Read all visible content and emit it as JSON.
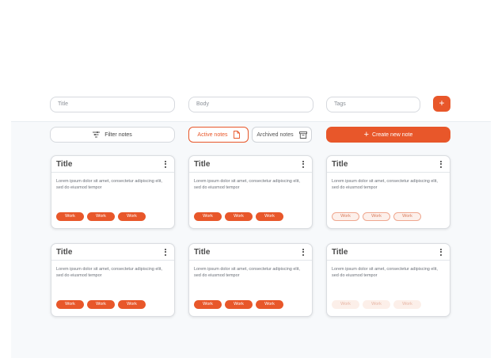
{
  "form": {
    "title_placeholder": "Title",
    "body_placeholder": "Body",
    "tags_placeholder": "Tags",
    "add_label": "+"
  },
  "toolbar": {
    "filter_label": "Filter notes",
    "active_label": "Active notes",
    "archived_label": "Archived notes",
    "create_label": "Create new note",
    "create_plus": "+"
  },
  "colors": {
    "accent": "#e8572a",
    "tag_outline_bg": "#fdf0eb",
    "tag_faint_bg": "#fcefe9"
  },
  "notes": [
    {
      "title": "Title",
      "body": "Lorem ipsum dolor sit amet, consectetur adipiscing elit, sed do eiusmod tempor",
      "tags": [
        "Work",
        "Work",
        "Work"
      ],
      "tag_style": "solid"
    },
    {
      "title": "Title",
      "body": "Lorem ipsum dolor sit amet, consectetur adipiscing elit, sed do eiusmod tempor",
      "tags": [
        "Work",
        "Work",
        "Work"
      ],
      "tag_style": "solid"
    },
    {
      "title": "Title",
      "body": "Lorem ipsum dolor sit amet, consectetur adipiscing elit, sed do eiusmod tempor",
      "tags": [
        "Work",
        "Work",
        "Work"
      ],
      "tag_style": "outline"
    },
    {
      "title": "Title",
      "body": "Lorem ipsum dolor sit amet, consectetur adipiscing elit, sed do eiusmod tempor",
      "tags": [
        "Work",
        "Work",
        "Work"
      ],
      "tag_style": "solid"
    },
    {
      "title": "Title",
      "body": "Lorem ipsum dolor sit amet, consectetur adipiscing elit, sed do eiusmod tempor",
      "tags": [
        "Work",
        "Work",
        "Work"
      ],
      "tag_style": "solid"
    },
    {
      "title": "Title",
      "body": "Lorem ipsum dolor sit amet, consectetur adipiscing elit, sed do eiusmod tempor",
      "tags": [
        "Work",
        "Work",
        "Work"
      ],
      "tag_style": "faint"
    }
  ]
}
